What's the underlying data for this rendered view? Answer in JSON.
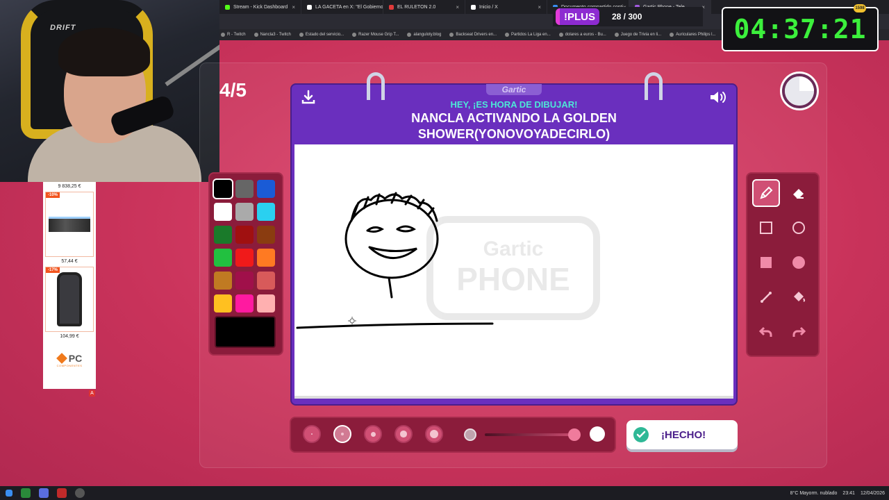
{
  "browser": {
    "tabs": [
      {
        "label": "Stream - Kick Dashboard",
        "color": "#53fc18"
      },
      {
        "label": "LA GACETA en X: \"El Gobierno",
        "color": "#ffffff"
      },
      {
        "label": "EL RULETON 2.0",
        "color": "#e03a3a"
      },
      {
        "label": "Inicio / X",
        "color": "#ffffff"
      },
      {
        "label": "Documento compartido conti",
        "color": "#3a8ef0"
      },
      {
        "label": "Gartic Phone - Tele",
        "color": "#a35be0"
      }
    ],
    "bookmarks": [
      "R - Twitch",
      "Nancla3 - Twitch",
      "Estado del servicio...",
      "Razer Mouse Grip T...",
      "alanguloty.blog",
      "Backseat Drivers en...",
      "Partidos La Liga en...",
      "dolares a euros - Bu...",
      "Juego de Trivia en li...",
      "Auriculares Philips l..."
    ]
  },
  "overlay": {
    "plus_label": "!PLUS",
    "progress_count": "28 / 300",
    "timer": "04:37:21",
    "notification_badge": "1598",
    "webcam_chair_brand": "DRIFT"
  },
  "ad": {
    "top_price": "9 838,25 €",
    "items": [
      {
        "discount": "-10%",
        "price": "57,44 €"
      },
      {
        "discount": "-17%",
        "price": "104,99 €"
      }
    ],
    "logo": "PC",
    "logo_sub": "COMPONENTES",
    "badge": "A"
  },
  "game": {
    "round": "4/5",
    "brand_tag": "Gartic",
    "instruction": "HEY, ¡ES HORA DE DIBUJAR!",
    "prompt": "NANCLA ACTIVANDO LA GOLDEN SHOWER(YONOVOYADECIRLO)",
    "watermark_top": "Gartic",
    "watermark_bottom": "PHONE",
    "timer_remaining": 0.75,
    "done_label": "¡HECHO!",
    "palette": [
      "#000000",
      "#666666",
      "#1a5bd6",
      "#ffffff",
      "#aaaaaa",
      "#2ad0f0",
      "#1a7a2a",
      "#a01010",
      "#8a3c10",
      "#22c040",
      "#f01a1a",
      "#ff7a22",
      "#c07a22",
      "#a0104a",
      "#d85a5a",
      "#ffc020",
      "#ff1aa0",
      "#ffb0b0"
    ],
    "selected_color": "#000000",
    "tools": [
      "pencil-icon",
      "eraser-icon",
      "rectangle-outline-icon",
      "circle-outline-icon",
      "rectangle-filled-icon",
      "circle-filled-icon",
      "line-icon",
      "fill-bucket-icon",
      "undo-icon",
      "redo-icon"
    ],
    "brush_sizes": 5,
    "selected_size": 2,
    "opacity_level": 0.95
  },
  "taskbar": {
    "weather": "8°C  Mayorm. nublado",
    "time": "23:41",
    "date": "12/04/2026"
  }
}
